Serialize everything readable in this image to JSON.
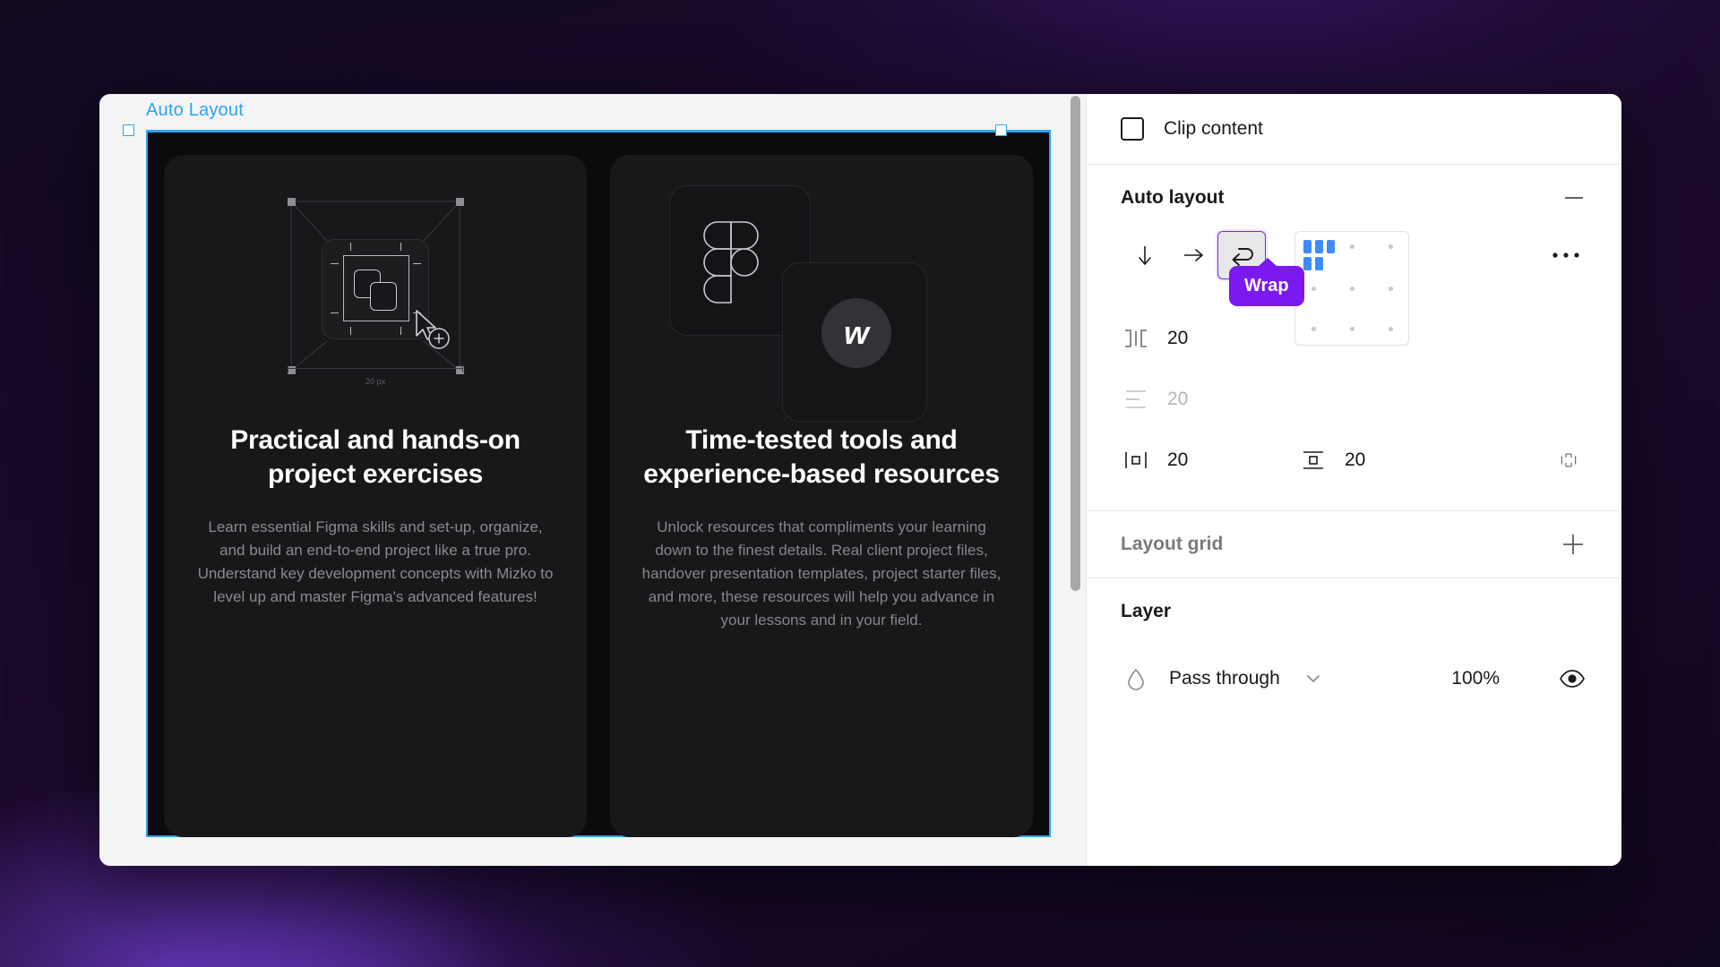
{
  "canvas": {
    "frame_label": "Auto Layout",
    "cards": [
      {
        "title": "Practical and hands-on project exercises",
        "body": "Learn essential Figma skills and set-up, organize, and build an end-to-end project like a true pro. Understand key development concepts with Mizko to level up and master Figma's advanced features!",
        "illustration": "selection-shapes-illustration",
        "dimension_label": "20 px"
      },
      {
        "title": "Time-tested tools and experience-based resources",
        "body": "Unlock resources that compliments your learning down to the finest details. Real client project files, handover presentation templates, project starter files, and more, these resources will help you advance in your lessons and in your field.",
        "illustration": "figma-webflow-tiles-illustration",
        "webflow_mark": "w"
      }
    ]
  },
  "panel": {
    "clip_content": {
      "label": "Clip content",
      "checked": false
    },
    "auto_layout": {
      "title": "Auto layout",
      "collapse_icon": "minus-icon",
      "direction": {
        "vertical": "arrow-down-icon",
        "horizontal": "arrow-right-icon",
        "wrap": "wrap-icon",
        "selected": "wrap"
      },
      "tooltip": "Wrap",
      "more_icon": "more-horizontal-icon",
      "gap_horizontal": {
        "icon": "horizontal-gap-icon",
        "value": "20"
      },
      "gap_vertical": {
        "icon": "vertical-gap-icon",
        "value": "20"
      },
      "padding_horizontal": {
        "icon": "horizontal-padding-icon",
        "value": "20"
      },
      "padding_vertical": {
        "icon": "vertical-padding-icon",
        "value": "20"
      },
      "individual_padding_icon": "individual-padding-icon"
    },
    "layout_grid": {
      "title": "Layout grid",
      "add_icon": "plus-icon"
    },
    "layer": {
      "title": "Layer",
      "blend_icon": "blend-drop-icon",
      "blend_mode": "Pass through",
      "chevron": "chevron-down-icon",
      "opacity": "100%",
      "visibility_icon": "eye-icon"
    }
  },
  "colors": {
    "accent_purple": "#7c18f0",
    "selection_blue": "#2aa4f4",
    "grid_blue": "#3d8bfd",
    "panel_bg": "#ffffff",
    "canvas_bg": "#f4f4f5",
    "card_bg": "#18181a"
  }
}
